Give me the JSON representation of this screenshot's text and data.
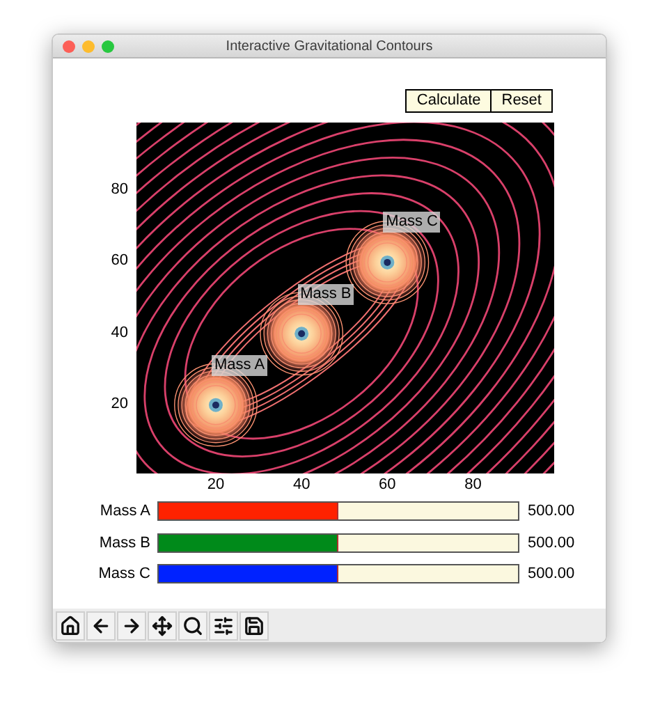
{
  "window": {
    "title": "Interactive Gravitational Contours"
  },
  "buttons": [
    {
      "label": "Calculate"
    },
    {
      "label": "Reset"
    }
  ],
  "plot": {
    "xticks": [
      "20",
      "40",
      "60",
      "80"
    ],
    "yticks": [
      "80",
      "60",
      "40",
      "20"
    ],
    "masses": [
      {
        "label": "Mass A"
      },
      {
        "label": "Mass B"
      },
      {
        "label": "Mass C"
      }
    ]
  },
  "sliders": [
    {
      "label": "Mass A",
      "level": 0.5,
      "reading": "500.00",
      "color": "#ff2200"
    },
    {
      "label": "Mass B",
      "level": 0.5,
      "reading": "500.00",
      "color": "#008a1a"
    },
    {
      "label": "Mass C",
      "level": 0.5,
      "reading": "500.00",
      "color": "#0022ff"
    }
  ],
  "toolbar": [
    {
      "kind": "home"
    },
    {
      "kind": "back"
    },
    {
      "kind": "forward"
    },
    {
      "kind": "pan"
    },
    {
      "kind": "zoom"
    },
    {
      "kind": "configure"
    },
    {
      "kind": "save"
    }
  ]
}
